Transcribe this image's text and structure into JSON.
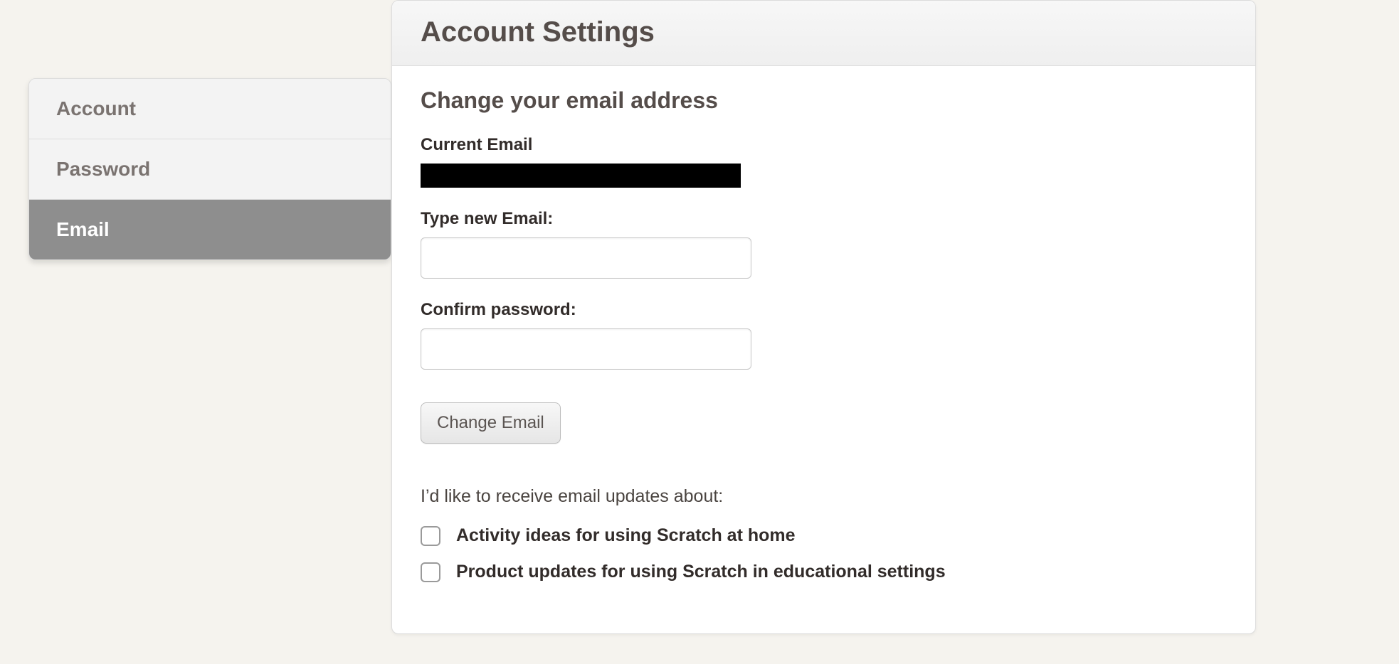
{
  "sidebar": {
    "items": [
      {
        "label": "Account",
        "active": false
      },
      {
        "label": "Password",
        "active": false
      },
      {
        "label": "Email",
        "active": true
      }
    ]
  },
  "header": {
    "title": "Account Settings"
  },
  "email_section": {
    "heading": "Change your email address",
    "current_email_label": "Current Email",
    "new_email_label": "Type new Email:",
    "new_email_value": "",
    "confirm_password_label": "Confirm password:",
    "confirm_password_value": "",
    "submit_label": "Change Email"
  },
  "preferences": {
    "intro": "I’d like to receive email updates about:",
    "options": [
      {
        "label": "Activity ideas for using Scratch at home",
        "checked": false
      },
      {
        "label": "Product updates for using Scratch in educational settings",
        "checked": false
      }
    ]
  }
}
